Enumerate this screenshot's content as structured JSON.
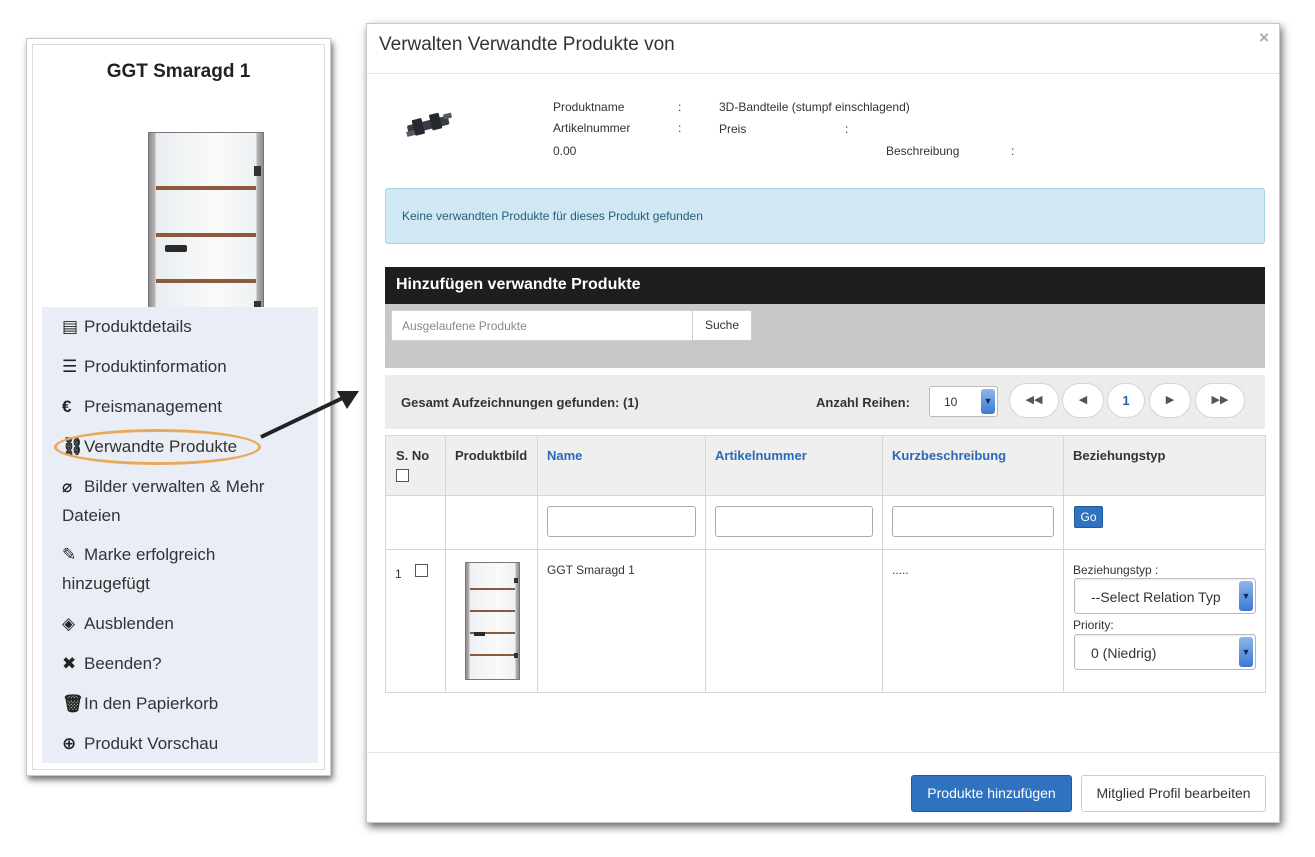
{
  "card": {
    "title": "GGT Smaragd 1",
    "menu": [
      {
        "icon": "list-alt-icon",
        "glyph": "▤",
        "label": "Produktdetails"
      },
      {
        "icon": "list-icon",
        "glyph": "☰",
        "label": "Produktinformation"
      },
      {
        "icon": "euro-icon",
        "glyph": "€",
        "label": "Preismanagement"
      },
      {
        "icon": "link-icon",
        "glyph": "⛓",
        "label": "Verwandte Produkte"
      },
      {
        "icon": "paperclip-icon",
        "glyph": "⌀",
        "label": "Bilder verwalten & Mehr Dateien"
      },
      {
        "icon": "edit-icon",
        "glyph": "✎",
        "label": "Marke erfolgreich hinzugefügt"
      },
      {
        "icon": "eye-slash-icon",
        "glyph": "◈",
        "label": "Ausblenden"
      },
      {
        "icon": "times-icon",
        "glyph": "✖",
        "label": "Beenden?"
      },
      {
        "icon": "trash-icon",
        "glyph": "🗑",
        "label": "In den Papierkorb"
      },
      {
        "icon": "zoom-icon",
        "glyph": "⊕",
        "label": "Produkt Vorschau"
      }
    ]
  },
  "modal": {
    "title": "Verwalten Verwandte Produkte von",
    "close": "×",
    "info": {
      "name_label": "Produktname",
      "name_sep": ":",
      "name_value": "3D-Bandteile (stumpf einschlagend)",
      "sku_label": "Artikelnummer",
      "sku_sep": ":",
      "price_label": "Preis",
      "price_sep": ":",
      "price_value": "0.00",
      "desc_label": "Beschreibung",
      "desc_sep": ":"
    },
    "alert": "Keine verwandten Produkte für dieses Produkt gefunden",
    "add_section": {
      "title": "Hinzufügen verwandte Produkte",
      "search_placeholder": "Ausgelaufene Produkte",
      "search_button": "Suche"
    },
    "pager": {
      "total": "Gesamt Aufzeichnungen gefunden: (1)",
      "rows_label": "Anzahl Reihen:",
      "rows_value": "10",
      "first": "◀◀",
      "prev": "◀",
      "page": "1",
      "next": "▶",
      "last": "▶▶"
    },
    "table": {
      "headers": {
        "sno": "S. No",
        "image": "Produktbild",
        "name": "Name",
        "sku": "Artikelnummer",
        "short_desc": "Kurzbeschreibung",
        "relation": "Beziehungstyp"
      },
      "go_button": "Go",
      "rows": [
        {
          "sno": "1",
          "name": "GGT Smaragd 1",
          "sku": "",
          "short_desc": ".....",
          "relation_label": "Beziehungstyp :",
          "relation_value": "--Select Relation Typ",
          "priority_label": "Priority:",
          "priority_value": "0 (Niedrig)"
        }
      ]
    },
    "footer": {
      "add_button": "Produkte hinzufügen",
      "edit_button": "Mitglied Profil bearbeiten"
    }
  },
  "colors": {
    "primary": "#2f72bf",
    "alert_bg": "#cfe8f3",
    "menu_bg": "#e9eef6",
    "highlight_ring": "#e9a95a",
    "section_header": "#1e1e1e"
  }
}
